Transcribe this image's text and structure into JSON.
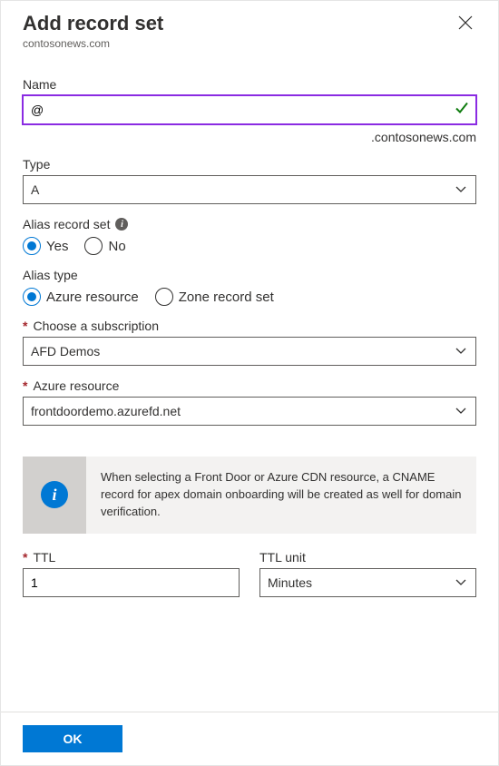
{
  "header": {
    "title": "Add record set",
    "subtitle": "contosonews.com"
  },
  "name": {
    "label": "Name",
    "value": "@",
    "suffix": ".contosonews.com"
  },
  "type": {
    "label": "Type",
    "value": "A"
  },
  "alias_record_set": {
    "label": "Alias record set",
    "options": {
      "yes": "Yes",
      "no": "No"
    },
    "selected": "yes"
  },
  "alias_type": {
    "label": "Alias type",
    "options": {
      "azure_resource": "Azure resource",
      "zone_record_set": "Zone record set"
    },
    "selected": "azure_resource"
  },
  "subscription": {
    "label": "Choose a subscription",
    "value": "AFD Demos"
  },
  "azure_resource": {
    "label": "Azure resource",
    "value": "frontdoordemo.azurefd.net"
  },
  "info_banner": {
    "message": "When selecting a Front Door or Azure CDN resource, a CNAME record for apex domain onboarding will be created as well for domain verification."
  },
  "ttl": {
    "label": "TTL",
    "value": "1",
    "unit_label": "TTL unit",
    "unit_value": "Minutes"
  },
  "footer": {
    "ok": "OK"
  }
}
